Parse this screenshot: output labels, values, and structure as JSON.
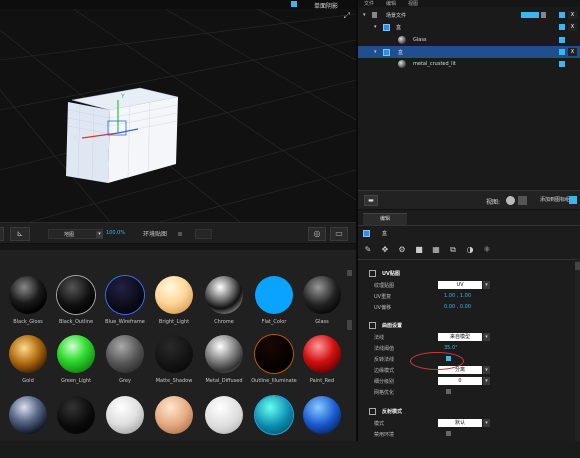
{
  "viewport": {
    "menu_label": "单面阴影",
    "mode": "地图",
    "zoom": "100.0%",
    "env_label": "环境贴图",
    "axis_x": "X",
    "axis_y": "Y"
  },
  "materials": [
    {
      "name": "Black_Gloss"
    },
    {
      "name": "Black_Outline"
    },
    {
      "name": "Blue_Wireframe"
    },
    {
      "name": "Bright_Light"
    },
    {
      "name": "Chrome"
    },
    {
      "name": "Flat_Color"
    },
    {
      "name": "Glass"
    },
    {
      "name": "Gold"
    },
    {
      "name": "Green_Light"
    },
    {
      "name": "Grey"
    },
    {
      "name": "Matte_Shadow"
    },
    {
      "name": "Metal_Diffused"
    },
    {
      "name": "Outline_Illuminate"
    },
    {
      "name": "Paint_Red"
    },
    {
      "name": ""
    },
    {
      "name": ""
    },
    {
      "name": ""
    },
    {
      "name": ""
    },
    {
      "name": ""
    },
    {
      "name": ""
    },
    {
      "name": ""
    }
  ],
  "scene": {
    "menu": [
      "文件",
      "编辑",
      "视图"
    ],
    "tree": [
      {
        "label": "场景文件",
        "indent": 0
      },
      {
        "label": "盒",
        "indent": 1
      },
      {
        "label": "Glass",
        "indent": 2
      },
      {
        "label": "盒",
        "indent": 1,
        "selected": true
      },
      {
        "label": "metal_crusted_lit",
        "indent": 2
      }
    ],
    "delete_label": "X"
  },
  "scene_bar": {
    "view_label": "视图:",
    "add_texture": "添加到图标组"
  },
  "edit": {
    "tab": "编辑",
    "object_name": "盒",
    "sections": {
      "uv": {
        "title": "UV贴图",
        "texture_map_label": "纹理贴图",
        "texture_map_value": "UV",
        "uv_repeat_label": "UV重复",
        "uv_repeat_value": "1.00 , 1.00",
        "uv_offset_label": "UV偏移",
        "uv_offset_value": "0.00 , 0.00"
      },
      "surface": {
        "title": "曲面设置",
        "normals_label": "法线",
        "normals_value": "来自模型",
        "threshold_label": "法线阈值",
        "threshold_value": "35.0°",
        "flip_label": "反转法线",
        "flip_checked": true,
        "edge_label": "边缘模式",
        "edge_value": "分离",
        "subdiv_label": "细分级别",
        "subdiv_value": "0",
        "mesh_opt_label": "网格优化",
        "mesh_opt_checked": false
      },
      "reflect": {
        "title": "反射模式",
        "mode_label": "模式",
        "mode_value": "默认",
        "env_label": "禁用环境"
      }
    }
  }
}
